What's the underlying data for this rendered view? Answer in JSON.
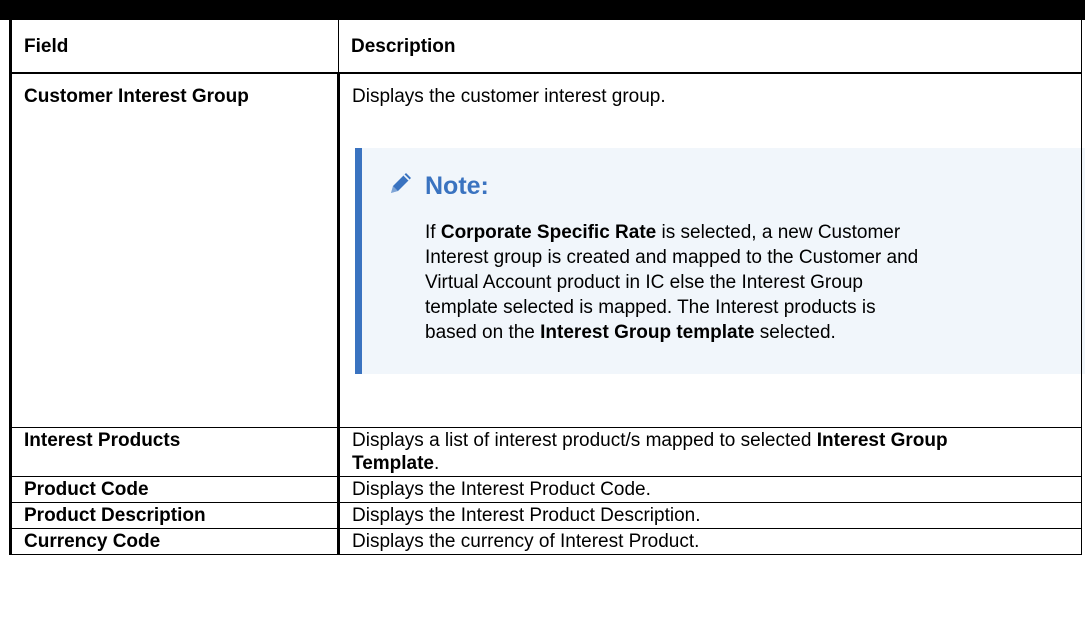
{
  "table": {
    "headers": {
      "field": "Field",
      "description": "Description"
    },
    "rows": [
      {
        "field": "Customer Interest Group",
        "description": "Displays the customer interest group."
      },
      {
        "field": "Interest Products",
        "desc_pre": "Displays a list of interest product/s mapped to selected ",
        "desc_bold": "Interest Group Template",
        "desc_post": "."
      },
      {
        "field": "Product Code",
        "description": "Displays the Interest Product Code."
      },
      {
        "field": "Product Description",
        "description": "Displays the Interest Product Description."
      },
      {
        "field": "Currency Code",
        "description": "Displays the currency of Interest Product."
      }
    ]
  },
  "note": {
    "icon": "pencil-icon",
    "accent_color": "#3a73c0",
    "title": "Note:",
    "p1": "If ",
    "b1": "Corporate Specific Rate",
    "p2": " is selected, a new Customer Interest group is created and mapped to the Customer and Virtual Account product in IC else the Interest Group template selected is mapped. The Interest products is based on the ",
    "b2": "Interest Group template",
    "p3": " selected."
  }
}
